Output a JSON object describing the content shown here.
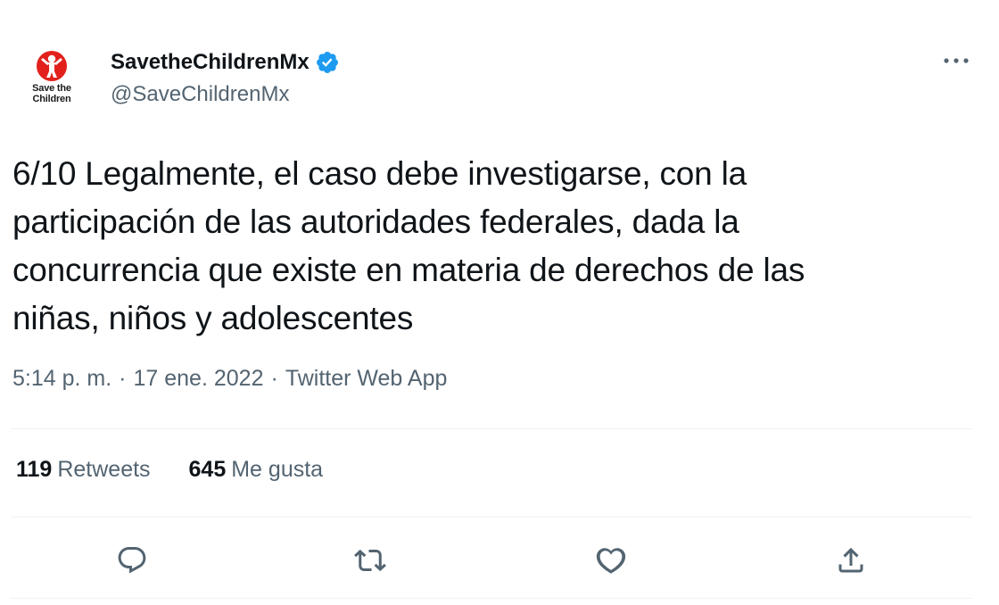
{
  "author": {
    "display_name": "SavetheChildrenMx",
    "handle": "@SaveChildrenMx",
    "verified": true,
    "avatar_logo_line1": "Save the",
    "avatar_logo_line2": "Children",
    "avatar_color": "#e2211c"
  },
  "tweet": {
    "text_lines": [
      "6/10 Legalmente, el caso debe investigarse, con la",
      "participación de las autoridades federales, dada la",
      "concurrencia que existe en materia de derechos de las",
      "niñas, niños y adolescentes"
    ],
    "time": "5:14 p. m.",
    "separator": "·",
    "date": "17 ene. 2022",
    "source": "Twitter Web App"
  },
  "stats": {
    "retweets_count": "119",
    "retweets_label": "Retweets",
    "likes_count": "645",
    "likes_label": "Me gusta"
  },
  "icons": {
    "more": "more-horizontal-icon",
    "verified": "verified-badge-icon",
    "reply": "reply-icon",
    "retweet": "retweet-icon",
    "like": "heart-icon",
    "share": "share-icon"
  },
  "colors": {
    "text": "#0f1419",
    "secondary": "#536471",
    "verified_blue": "#1d9bf0",
    "divider": "#eff3f4",
    "brand_red": "#e2211c"
  }
}
